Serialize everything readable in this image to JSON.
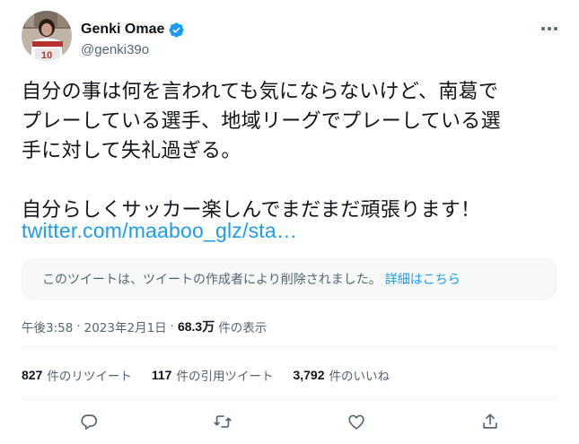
{
  "author": {
    "display_name": "Genki Omae",
    "handle": "@genki39o",
    "verified": true,
    "avatar_icon": "profile-photo"
  },
  "tweet": {
    "text": "自分の事は何を言われても気にならないけど、南葛で\nプレーしている選手、地域リーグでプレーしている選\n手に対して失礼過ぎる。\n\n自分らしくサッカー楽しんでまだまだ頑張ります！",
    "link": "twitter.com/maaboo_glz/sta…"
  },
  "deleted_notice": {
    "text": "このツイートは、ツイートの作成者により削除されました。",
    "link_label": "詳細はこちら"
  },
  "meta": {
    "time": "午後3:58",
    "date": "2023年2月1日",
    "separator": "·",
    "views_count": "68.3万",
    "views_label": "件の表示"
  },
  "stats": {
    "retweets_count": "827",
    "retweets_label": "件のリツイート",
    "quotes_count": "117",
    "quotes_label": "件の引用ツイート",
    "likes_count": "3,792",
    "likes_label": "件のいいね"
  },
  "actions": [
    "reply-icon",
    "retweet-icon",
    "like-icon",
    "share-icon"
  ],
  "colors": {
    "accent": "#1d9bf0",
    "text": "#0f1419",
    "muted": "#536471",
    "divider": "#eff3f4"
  }
}
